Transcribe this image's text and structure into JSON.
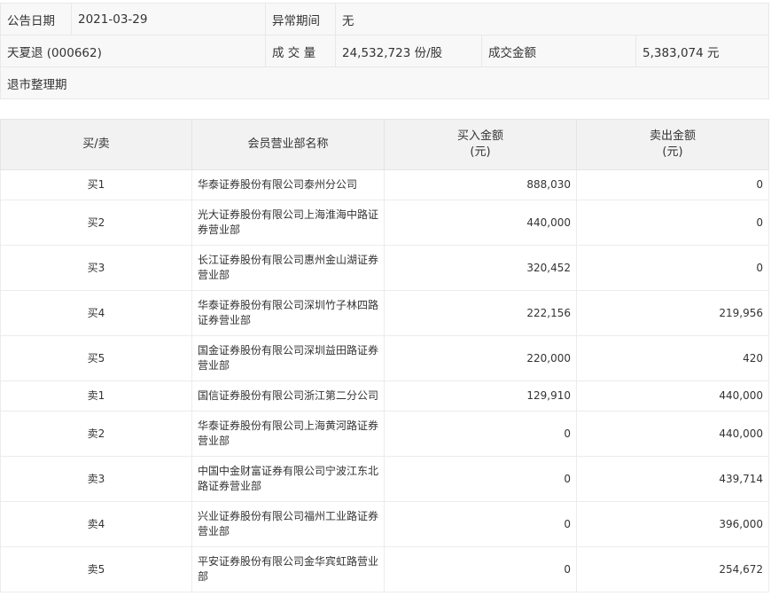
{
  "info": {
    "date_label": "公告日期",
    "date_value": "2021-03-29",
    "abnormal_label": "异常期间",
    "abnormal_value": "无",
    "stock_name": "天夏退 (000662)",
    "volume_label": "成 交 量",
    "volume_value": "24,532,723 份/股",
    "amount_label": "成交金额",
    "amount_value": "5,383,074 元",
    "reason": "退市整理期"
  },
  "table": {
    "headers": {
      "side": "买/卖",
      "broker": "会员营业部名称",
      "buy_line1": "买入金额",
      "buy_line2": "(元)",
      "sell_line1": "卖出金额",
      "sell_line2": "(元)"
    },
    "rows": [
      {
        "side": "买1",
        "broker": "华泰证券股份有限公司泰州分公司",
        "buy": "888,030",
        "sell": "0"
      },
      {
        "side": "买2",
        "broker": "光大证券股份有限公司上海淮海中路证券营业部",
        "buy": "440,000",
        "sell": "0"
      },
      {
        "side": "买3",
        "broker": "长江证券股份有限公司惠州金山湖证券营业部",
        "buy": "320,452",
        "sell": "0"
      },
      {
        "side": "买4",
        "broker": "华泰证券股份有限公司深圳竹子林四路证券营业部",
        "buy": "222,156",
        "sell": "219,956"
      },
      {
        "side": "买5",
        "broker": "国金证券股份有限公司深圳益田路证券营业部",
        "buy": "220,000",
        "sell": "420"
      },
      {
        "side": "卖1",
        "broker": "国信证券股份有限公司浙江第二分公司",
        "buy": "129,910",
        "sell": "440,000"
      },
      {
        "side": "卖2",
        "broker": "华泰证券股份有限公司上海黄河路证券营业部",
        "buy": "0",
        "sell": "440,000"
      },
      {
        "side": "卖3",
        "broker": "中国中金财富证券有限公司宁波江东北路证券营业部",
        "buy": "0",
        "sell": "439,714"
      },
      {
        "side": "卖4",
        "broker": "兴业证券股份有限公司福州工业路证券营业部",
        "buy": "0",
        "sell": "396,000"
      },
      {
        "side": "卖5",
        "broker": "平安证券股份有限公司金华宾虹路营业部",
        "buy": "0",
        "sell": "254,672"
      }
    ]
  }
}
